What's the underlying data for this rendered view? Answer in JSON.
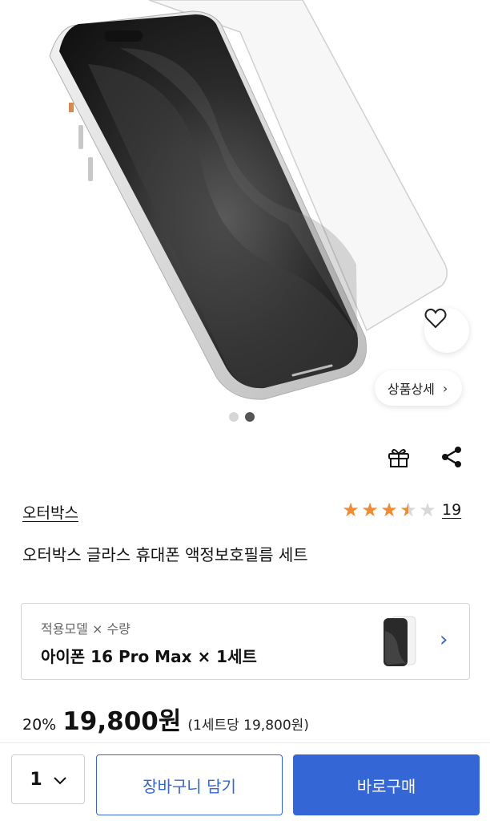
{
  "hero": {
    "detail_label": "상품상세",
    "detail_chevron": "›",
    "wish_icon": "heart-outline-icon"
  },
  "carousel": {
    "total": 2,
    "active": 2
  },
  "actions": {
    "gift_icon": "gift-icon",
    "share_icon": "share-icon"
  },
  "product": {
    "brand": "오터박스",
    "title": "오터박스 글라스 휴대폰 액정보호필름 세트",
    "rating": 3.5,
    "rating_max": 5,
    "review_count": "19"
  },
  "option": {
    "label": "적용모델 × 수량",
    "value": "아이폰 16 Pro Max × 1세트",
    "chevron": "›"
  },
  "price": {
    "discount": "20%",
    "amount": "19,800원",
    "unit": "(1세트당 19,800원)"
  },
  "bottom": {
    "qty": "1",
    "qty_chevron": "∨",
    "cart_label": "장바구니 담기",
    "buy_label": "바로구매"
  },
  "colors": {
    "accent": "#3466d6",
    "star": "#f28a2e"
  }
}
